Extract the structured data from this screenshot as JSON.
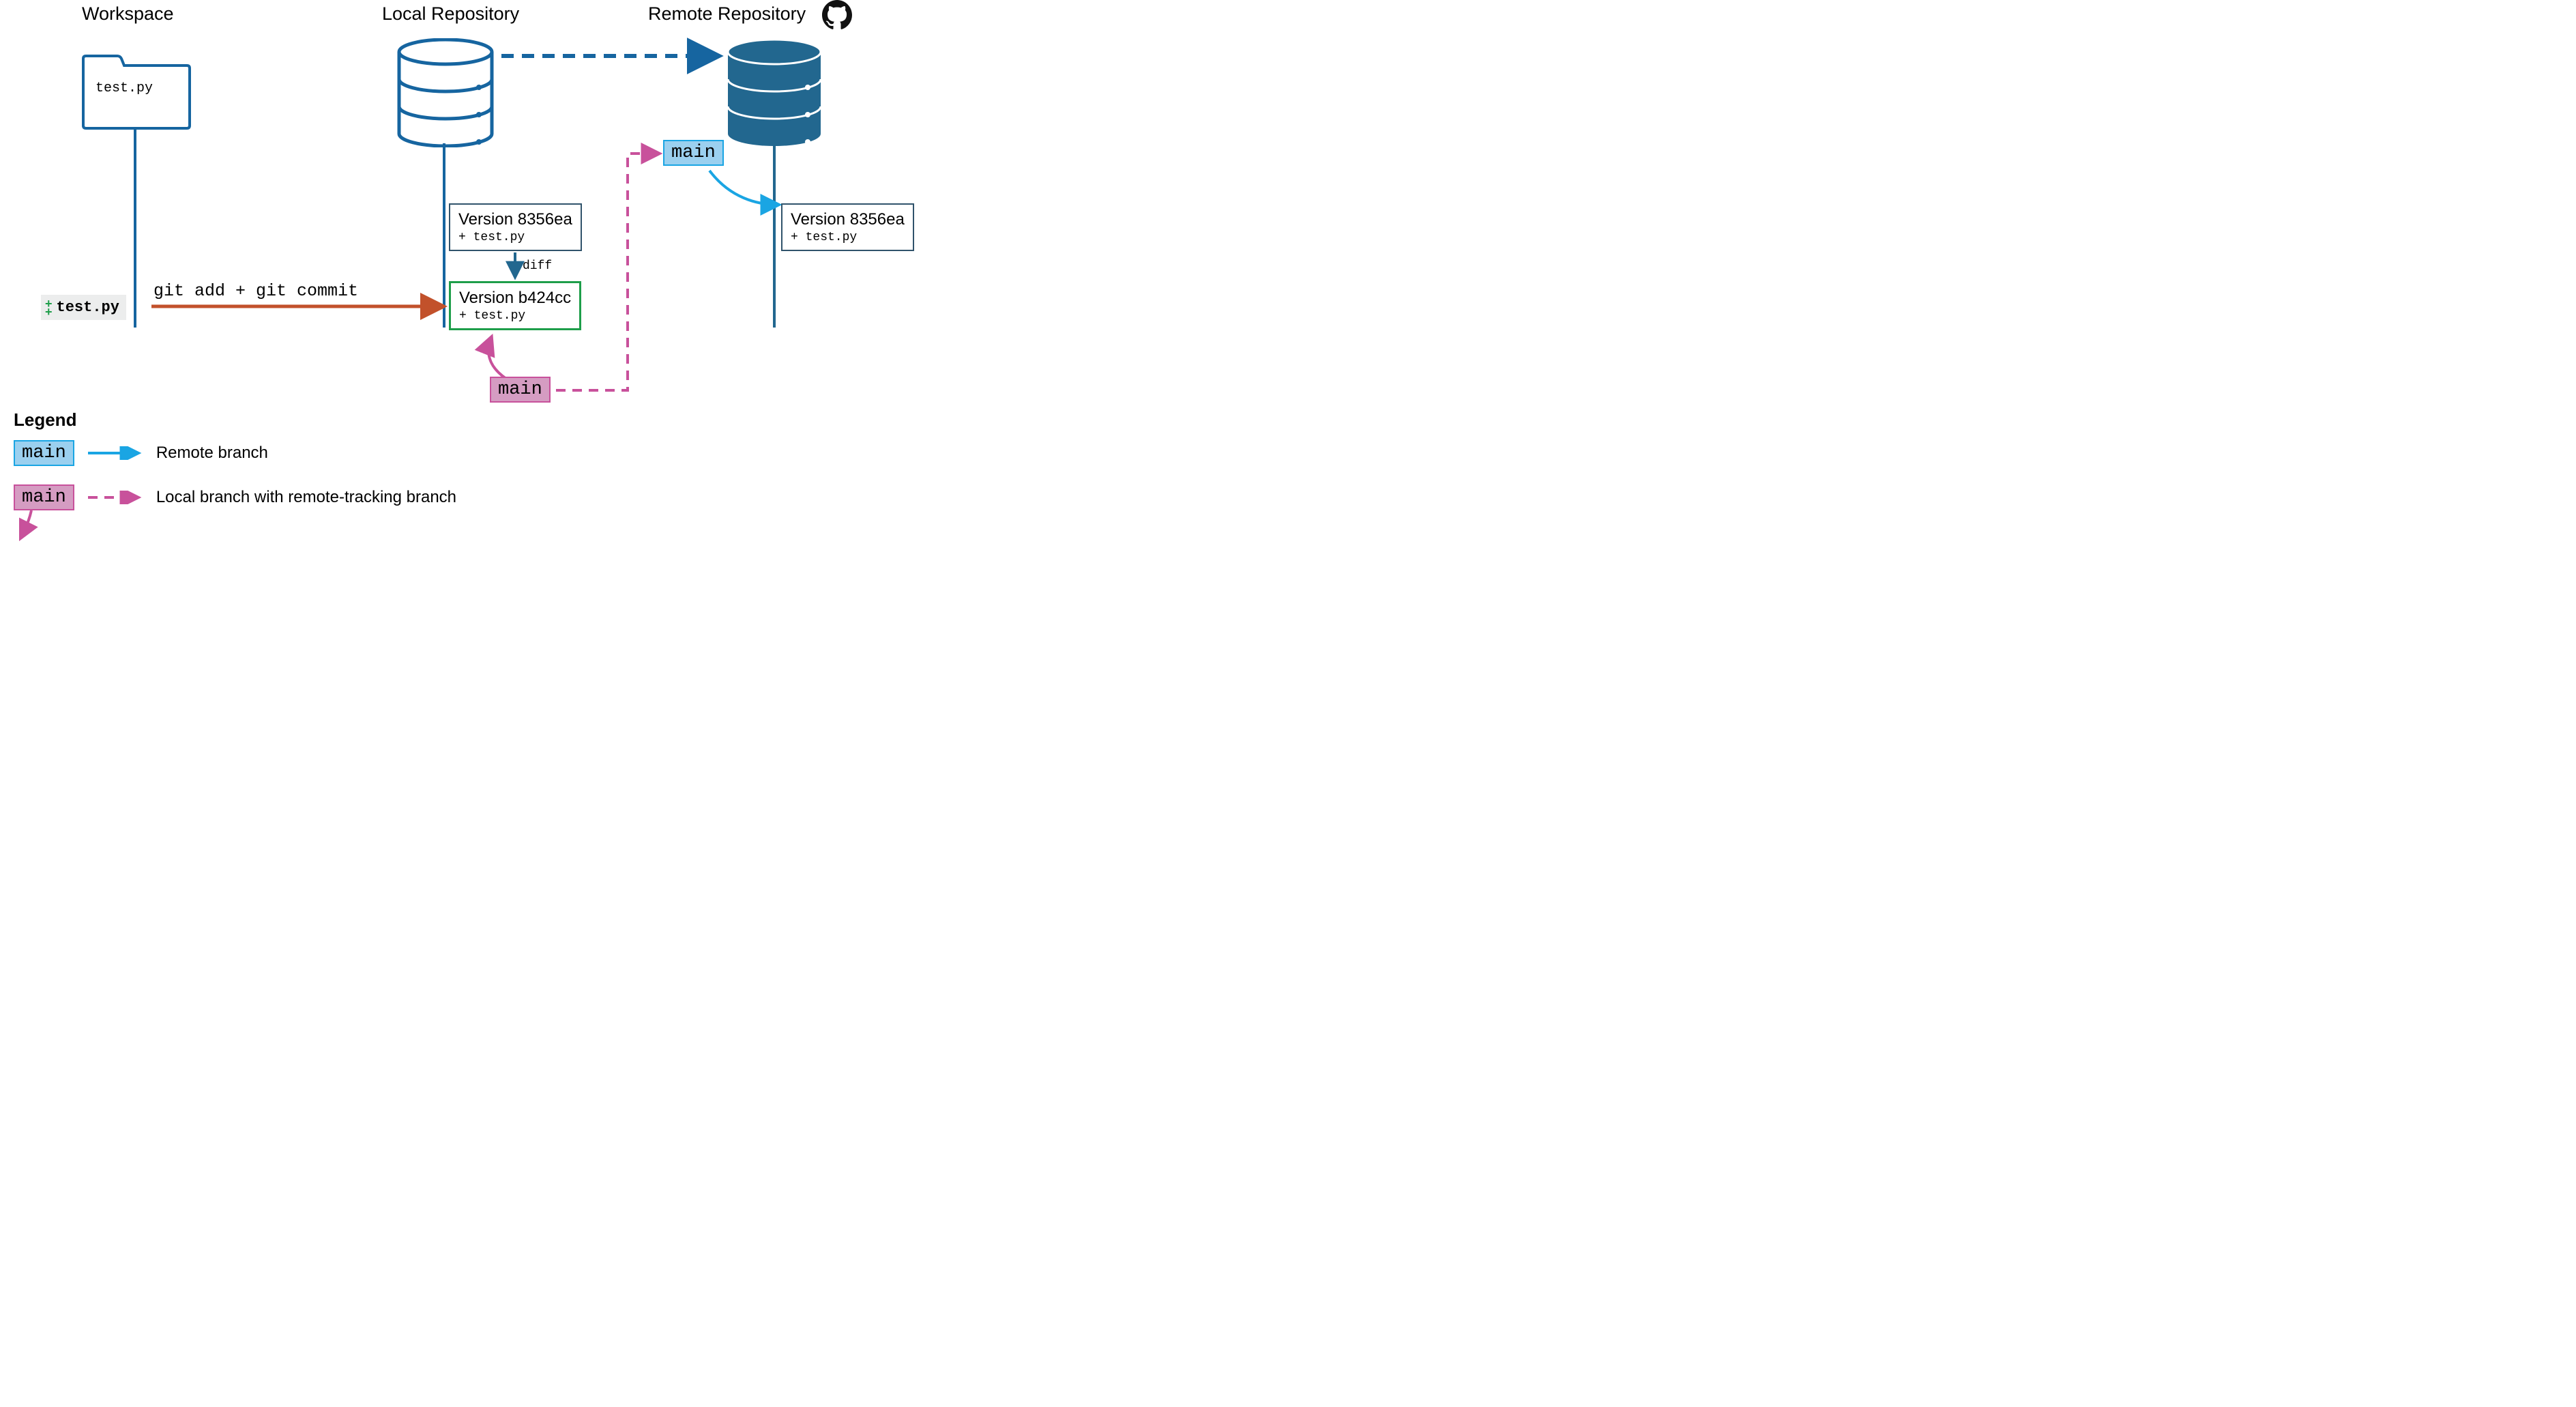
{
  "headings": {
    "workspace": "Workspace",
    "local_repo": "Local Repository",
    "remote_repo": "Remote Repository"
  },
  "folder": {
    "filename": "test.py"
  },
  "file_chip": {
    "filename": "test.py"
  },
  "commands": {
    "add_commit": "git add + git commit",
    "diff": "diff"
  },
  "versions": {
    "local_v1": {
      "title": "Version 8356ea",
      "sub": "+ test.py"
    },
    "local_v2": {
      "title": "Version b424cc",
      "sub": "+ test.py"
    },
    "remote_v1": {
      "title": "Version 8356ea",
      "sub": "+ test.py"
    }
  },
  "branches": {
    "remote_main": "main",
    "local_main": "main"
  },
  "legend": {
    "title": "Legend",
    "remote_tag": "main",
    "remote_text": "Remote branch",
    "local_tag": "main",
    "local_text": "Local branch with remote-tracking branch"
  },
  "colors": {
    "blue_outline": "#1665a0",
    "blue_fill_light": "#fff",
    "remote_db_fill": "#22678f",
    "remote_db_stroke": "#22678f",
    "green": "#1e9e4a",
    "orange": "#c2512b",
    "magenta": "#c8519b",
    "magenta_fill": "#d59cc2",
    "cyan": "#1aa5e3",
    "cyan_fill": "#9bd0ef",
    "gray_box": "#30536b",
    "black": "#111"
  }
}
